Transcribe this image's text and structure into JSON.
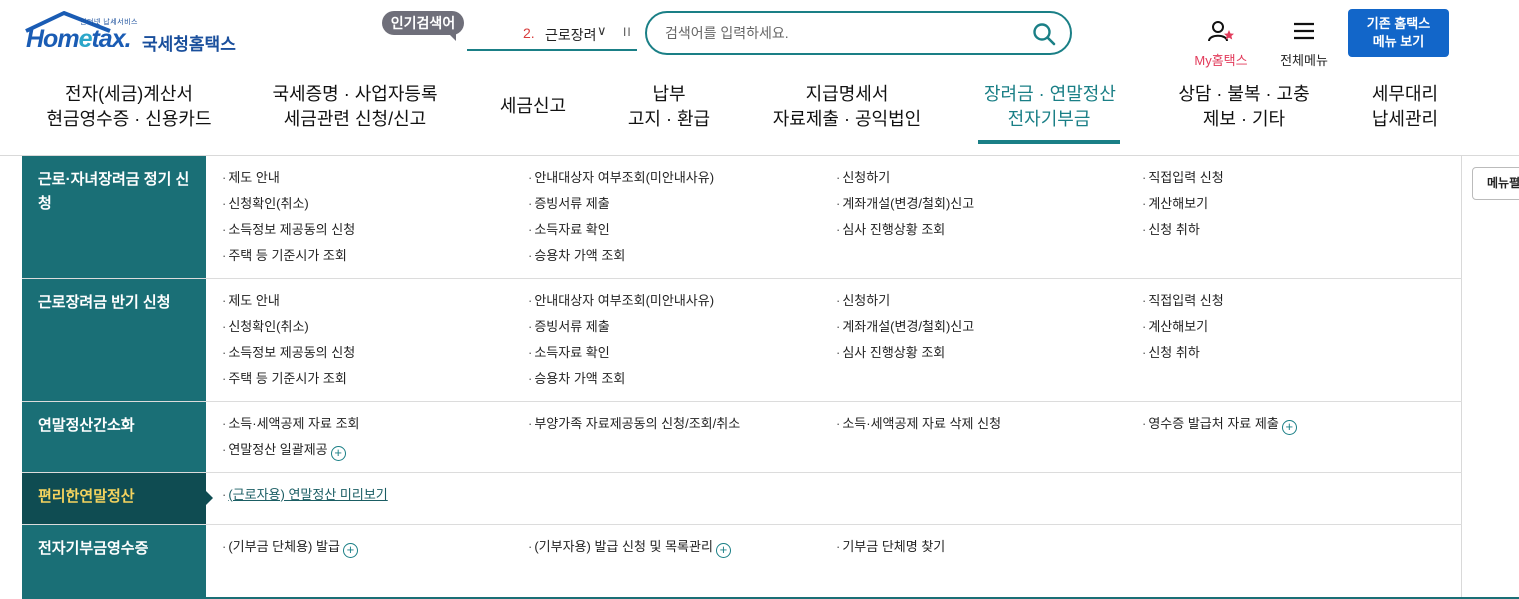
{
  "header": {
    "logo": {
      "sub": "인터넷 납세서비스",
      "brand_a": "Hom",
      "brand_e": "e",
      "brand_b": "tax.",
      "name": "국세청홈택스"
    },
    "popular": {
      "badge": "인기검색어",
      "rank": "2.",
      "keyword": "근로장려",
      "chevron": "∨",
      "pause": "II"
    },
    "search": {
      "placeholder": "검색어를 입력하세요.",
      "icon": "search-icon"
    },
    "my_hometax": {
      "label": "My홈택스",
      "icon": "user-star-icon"
    },
    "all_menu": {
      "label": "전체메뉴",
      "icon": "hamburger-icon"
    },
    "legacy_button": "기존 홈택스\n메뉴 보기"
  },
  "gnb": [
    {
      "line1": "전자(세금)계산서",
      "line2": "현금영수증 · 신용카드"
    },
    {
      "line1": "국세증명 · 사업자등록",
      "line2": "세금관련 신청/신고"
    },
    {
      "line1": "세금신고",
      "line2": ""
    },
    {
      "line1": "납부",
      "line2": "고지 · 환급"
    },
    {
      "line1": "지급명세서",
      "line2": "자료제출 · 공익법인"
    },
    {
      "line1": "장려금 · 연말정산",
      "line2": "전자기부금",
      "active": true
    },
    {
      "line1": "상담 · 불복 · 고충",
      "line2": "제보 · 기타"
    },
    {
      "line1": "세무대리",
      "line2": "납세관리"
    }
  ],
  "mega": {
    "rows": [
      {
        "category": "근로·자녀장려금 정기 신청",
        "items": [
          [
            "제도 안내",
            "안내대상자 여부조회(미안내사유)",
            "신청하기",
            "직접입력 신청"
          ],
          [
            "신청확인(취소)",
            "증빙서류 제출",
            "계좌개설(변경/철회)신고",
            "계산해보기"
          ],
          [
            "소득정보 제공동의 신청",
            "소득자료 확인",
            "심사 진행상황 조회",
            "신청 취하"
          ],
          [
            "주택 등 기준시가 조회",
            "승용차 가액 조회"
          ]
        ]
      },
      {
        "category": "근로장려금 반기 신청",
        "items": [
          [
            "제도 안내",
            "안내대상자 여부조회(미안내사유)",
            "신청하기",
            "직접입력 신청"
          ],
          [
            "신청확인(취소)",
            "증빙서류 제출",
            "계좌개설(변경/철회)신고",
            "계산해보기"
          ],
          [
            "소득정보 제공동의 신청",
            "소득자료 확인",
            "심사 진행상황 조회",
            "신청 취하"
          ],
          [
            "주택 등 기준시가 조회",
            "승용차 가액 조회"
          ]
        ]
      },
      {
        "category": "연말정산간소화",
        "items": [
          [
            "소득·세액공제 자료 조회",
            "부양가족 자료제공동의 신청/조회/취소",
            "소득·세액공제 자료 삭제 신청",
            "영수증 발급처 자료 제출"
          ],
          [
            "연말정산 일괄제공"
          ]
        ]
      },
      {
        "category": "편리한연말정산",
        "items": [
          [
            "(근로자용) 연말정산 미리보기"
          ]
        ]
      },
      {
        "category": "전자기부금영수증",
        "items": [
          [
            "(기부금 단체용) 발급",
            "(기부자용) 발급 신청 및 목록관리",
            "기부금 단체명 찾기"
          ]
        ]
      }
    ],
    "plus_symbol": "+",
    "bullet": "·"
  },
  "side_button": "메뉴펼"
}
